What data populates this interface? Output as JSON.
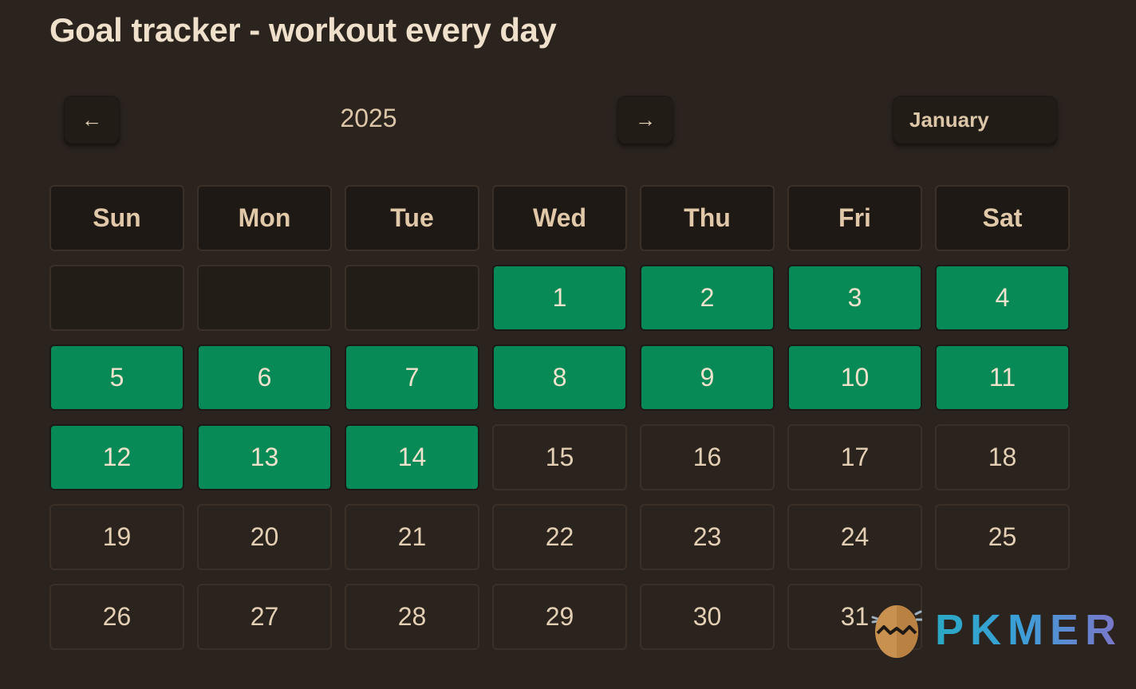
{
  "title": "Goal tracker - workout every day",
  "nav": {
    "prev_icon": "←",
    "next_icon": "→",
    "year": "2025",
    "month_selected": "January"
  },
  "weekdays": [
    "Sun",
    "Mon",
    "Tue",
    "Wed",
    "Thu",
    "Fri",
    "Sat"
  ],
  "calendar": {
    "leading_empty_cells": 3,
    "days": [
      {
        "day": "1",
        "done": true
      },
      {
        "day": "2",
        "done": true
      },
      {
        "day": "3",
        "done": true
      },
      {
        "day": "4",
        "done": true
      },
      {
        "day": "5",
        "done": true
      },
      {
        "day": "6",
        "done": true
      },
      {
        "day": "7",
        "done": true
      },
      {
        "day": "8",
        "done": true
      },
      {
        "day": "9",
        "done": true
      },
      {
        "day": "10",
        "done": true
      },
      {
        "day": "11",
        "done": true
      },
      {
        "day": "12",
        "done": true
      },
      {
        "day": "13",
        "done": true
      },
      {
        "day": "14",
        "done": true
      },
      {
        "day": "15",
        "done": false
      },
      {
        "day": "16",
        "done": false
      },
      {
        "day": "17",
        "done": false
      },
      {
        "day": "18",
        "done": false
      },
      {
        "day": "19",
        "done": false
      },
      {
        "day": "20",
        "done": false
      },
      {
        "day": "21",
        "done": false
      },
      {
        "day": "22",
        "done": false
      },
      {
        "day": "23",
        "done": false
      },
      {
        "day": "24",
        "done": false
      },
      {
        "day": "25",
        "done": false
      },
      {
        "day": "26",
        "done": false
      },
      {
        "day": "27",
        "done": false
      },
      {
        "day": "28",
        "done": false
      },
      {
        "day": "29",
        "done": false
      },
      {
        "day": "30",
        "done": false
      },
      {
        "day": "31",
        "done": false
      }
    ],
    "done_color": "#078a55"
  },
  "watermark": {
    "icon": "egg-logo-icon",
    "text": "PKMER"
  }
}
